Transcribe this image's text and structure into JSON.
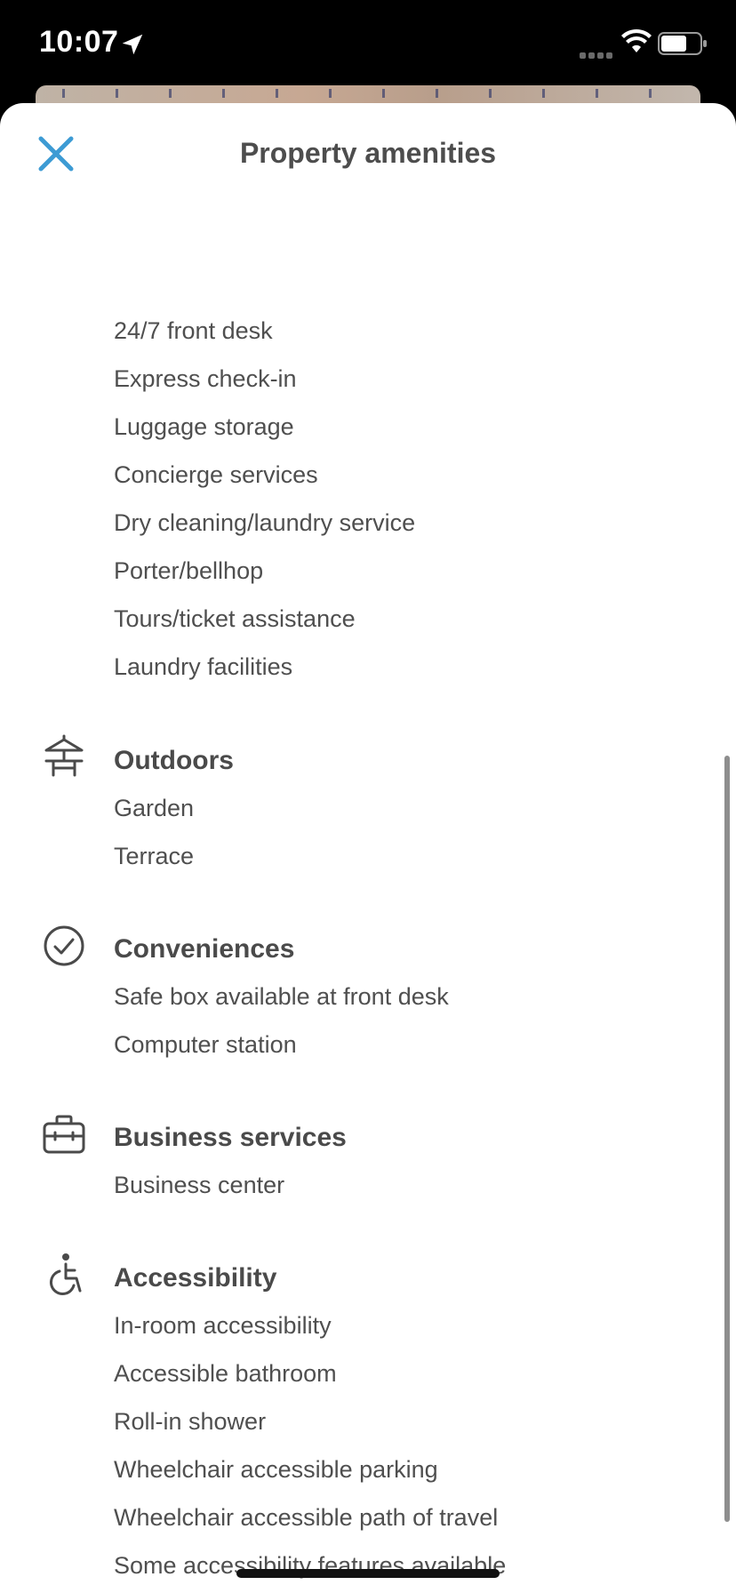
{
  "status_bar": {
    "time": "10:07"
  },
  "sheet": {
    "title": "Property amenities"
  },
  "sections": {
    "general": {
      "items": [
        "24/7 front desk",
        "Express check-in",
        "Luggage storage",
        "Concierge services",
        "Dry cleaning/laundry service",
        "Porter/bellhop",
        "Tours/ticket assistance",
        "Laundry facilities"
      ]
    },
    "outdoors": {
      "heading": "Outdoors",
      "icon": "outdoor-table-icon",
      "items": [
        "Garden",
        "Terrace"
      ]
    },
    "conveniences": {
      "heading": "Conveniences",
      "icon": "check-circle-icon",
      "items": [
        "Safe box available at front desk",
        "Computer station"
      ]
    },
    "business": {
      "heading": "Business services",
      "icon": "briefcase-icon",
      "items": [
        "Business center"
      ]
    },
    "accessibility": {
      "heading": "Accessibility",
      "icon": "wheelchair-icon",
      "items": [
        "In-room accessibility",
        "Accessible bathroom",
        "Roll-in shower",
        "Wheelchair accessible parking",
        "Wheelchair accessible path of travel",
        "Some accessibility features available"
      ]
    }
  },
  "colors": {
    "accent": "#3d9bd4",
    "text": "#4f4f4f"
  }
}
